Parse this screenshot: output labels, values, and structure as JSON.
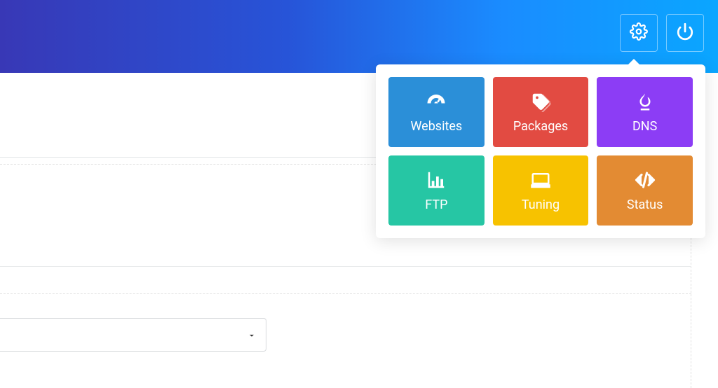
{
  "topbar": {
    "settings_icon": "gear",
    "power_icon": "power"
  },
  "dropdown": {
    "tiles": [
      {
        "label": "Websites",
        "icon": "dashboard",
        "color": "blue"
      },
      {
        "label": "Packages",
        "icon": "tags",
        "color": "red"
      },
      {
        "label": "DNS",
        "icon": "flame",
        "color": "purple"
      },
      {
        "label": "FTP",
        "icon": "chart",
        "color": "teal"
      },
      {
        "label": "Tuning",
        "icon": "laptop",
        "color": "yellow"
      },
      {
        "label": "Status",
        "icon": "code",
        "color": "orange"
      }
    ]
  },
  "form": {
    "select_value": ""
  }
}
